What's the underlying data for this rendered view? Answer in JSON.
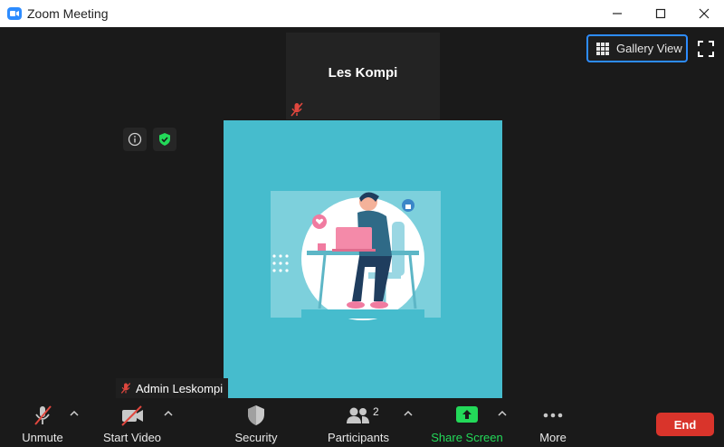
{
  "window": {
    "title": "Zoom Meeting",
    "controls": [
      "minimize",
      "maximize",
      "close"
    ]
  },
  "remote_participant": {
    "name": "Les Kompi",
    "muted": true
  },
  "view": {
    "gallery_label": "Gallery View"
  },
  "self_view": {
    "name": "Admin Leskompi",
    "muted": true,
    "background_color": "#46bccd"
  },
  "toolbar": {
    "unmute_label": "Unmute",
    "start_video_label": "Start Video",
    "security_label": "Security",
    "participants_label": "Participants",
    "participants_count": "2",
    "share_screen_label": "Share Screen",
    "more_label": "More",
    "end_label": "End"
  },
  "colors": {
    "accent_blue": "#2d8cff",
    "share_green": "#23d959",
    "end_red": "#d9342b",
    "mute_red": "#e0473e"
  }
}
